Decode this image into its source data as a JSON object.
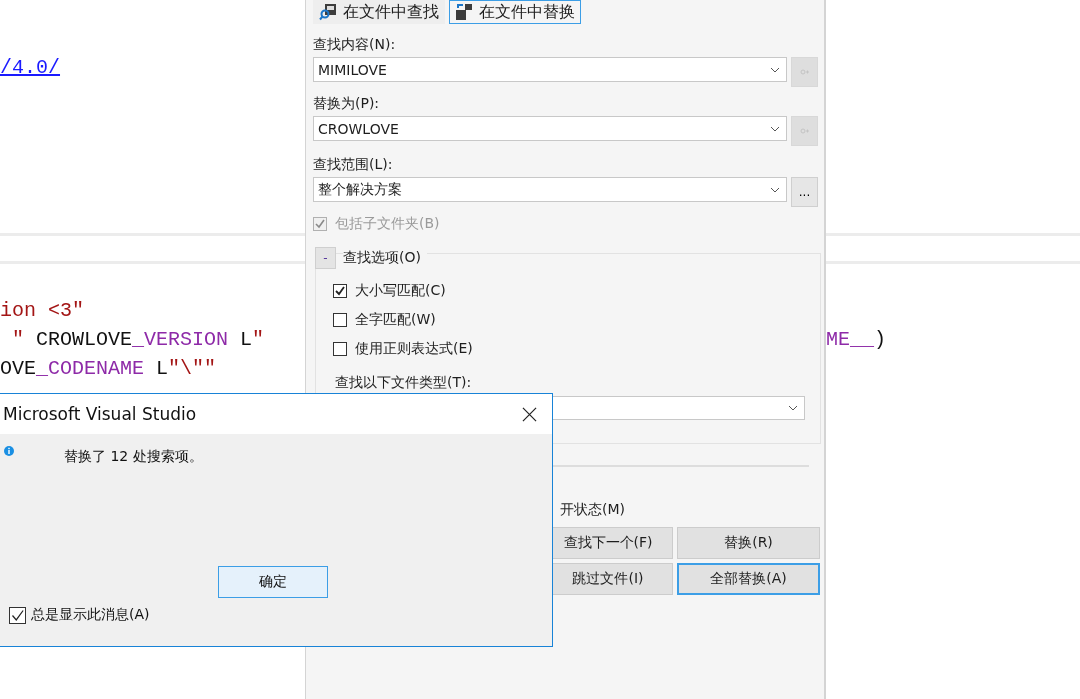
{
  "editor": {
    "link": "/4.0/",
    "lines": [
      {
        "segments": [
          {
            "text": "ion <3\"",
            "kind": "string"
          }
        ]
      },
      {
        "segments": [
          {
            "text": " \" ",
            "kind": "string"
          },
          {
            "text": "CROWLOVE",
            "kind": "plain"
          },
          {
            "text": "_VERSION",
            "kind": "macro"
          },
          {
            "text": " L",
            "kind": "plain"
          },
          {
            "text": "\"",
            "kind": "string"
          }
        ],
        "right_segments": [
          {
            "text": "ME__",
            "kind": "macro"
          },
          {
            "text": ")",
            "kind": "plain"
          }
        ]
      },
      {
        "segments": [
          {
            "text": "OVE",
            "kind": "plain"
          },
          {
            "text": "_CODENAME",
            "kind": "macro"
          },
          {
            "text": " L",
            "kind": "plain"
          },
          {
            "text": "\"\\\"\"",
            "kind": "string"
          }
        ]
      }
    ]
  },
  "panel": {
    "tabs": [
      {
        "label": "在文件中查找",
        "selected": false,
        "kind": "find"
      },
      {
        "label": "在文件中替换",
        "selected": true,
        "kind": "replace"
      }
    ],
    "find": {
      "label": "查找内容(N):",
      "value": "MIMILOVE"
    },
    "replace": {
      "label": "替换为(P):",
      "value": "CROWLOVE"
    },
    "scope": {
      "label": "查找范围(L):",
      "value": "整个解决方案",
      "browse": "..."
    },
    "include_subfolders": {
      "label": "包括子文件夹(B)",
      "checked": true,
      "disabled": true
    },
    "options": {
      "toggle": "-",
      "title": "查找选项(O)",
      "expanded": true,
      "checks": [
        {
          "label": "大小写匹配(C)",
          "checked": true
        },
        {
          "label": "全字匹配(W)",
          "checked": false
        },
        {
          "label": "使用正则表达式(E)",
          "checked": false
        }
      ],
      "file_types_label": "查找以下文件类型(T):"
    },
    "keep_open_label": "开状态(M)",
    "buttons": [
      {
        "label": "查找下一个(F)",
        "focused": false
      },
      {
        "label": "替换(R)",
        "focused": false
      },
      {
        "label": "跳过文件(I)",
        "focused": false
      },
      {
        "label": "全部替换(A)",
        "focused": true
      }
    ]
  },
  "dialog": {
    "title": "Microsoft Visual Studio",
    "message": "替换了 12 处搜索项。",
    "ok": "确定",
    "always_show": {
      "label": "总是显示此消息(A)",
      "checked": true
    }
  }
}
